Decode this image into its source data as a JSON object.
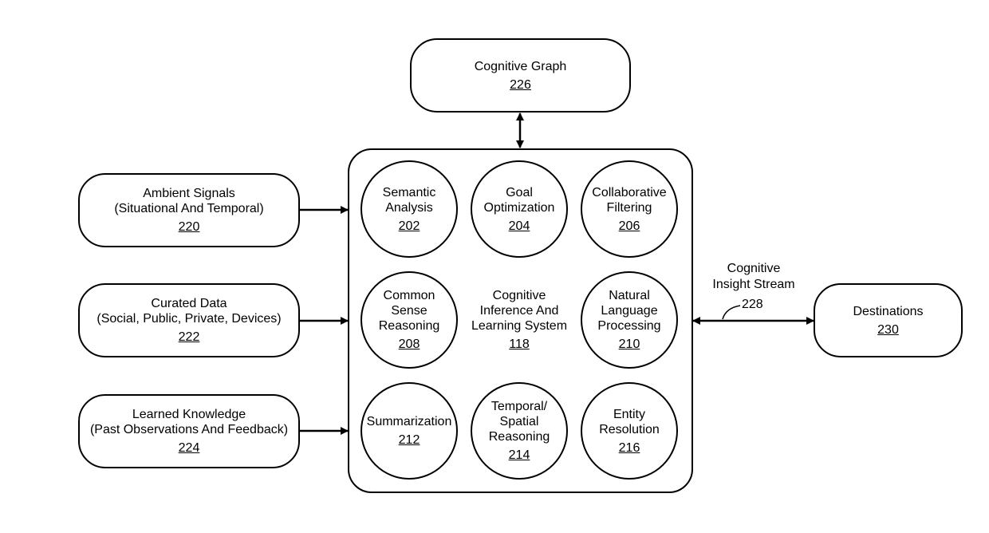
{
  "cognitive_graph": {
    "title": "Cognitive Graph",
    "ref": "226"
  },
  "inputs": [
    {
      "title": "Ambient Signals",
      "subtitle": "(Situational And Temporal)",
      "ref": "220"
    },
    {
      "title": "Curated Data",
      "subtitle": "(Social, Public, Private, Devices)",
      "ref": "222"
    },
    {
      "title": "Learned Knowledge",
      "subtitle": "(Past Observations And Feedback)",
      "ref": "224"
    }
  ],
  "system": {
    "title_lines": [
      "Cognitive",
      "Inference And",
      "Learning System"
    ],
    "ref": "118",
    "modules": [
      {
        "lines": [
          "Semantic",
          "Analysis"
        ],
        "ref": "202"
      },
      {
        "lines": [
          "Goal",
          "Optimization"
        ],
        "ref": "204"
      },
      {
        "lines": [
          "Collaborative",
          "Filtering"
        ],
        "ref": "206"
      },
      {
        "lines": [
          "Common",
          "Sense",
          "Reasoning"
        ],
        "ref": "208"
      },
      {
        "lines": [
          "Natural",
          "Language",
          "Processing"
        ],
        "ref": "210"
      },
      {
        "lines": [
          "Summarization"
        ],
        "ref": "212"
      },
      {
        "lines": [
          "Temporal/",
          "Spatial",
          "Reasoning"
        ],
        "ref": "214"
      },
      {
        "lines": [
          "Entity",
          "Resolution"
        ],
        "ref": "216"
      }
    ]
  },
  "stream": {
    "lines": [
      "Cognitive",
      "Insight Stream"
    ],
    "ref": "228"
  },
  "destinations": {
    "title": "Destinations",
    "ref": "230"
  }
}
